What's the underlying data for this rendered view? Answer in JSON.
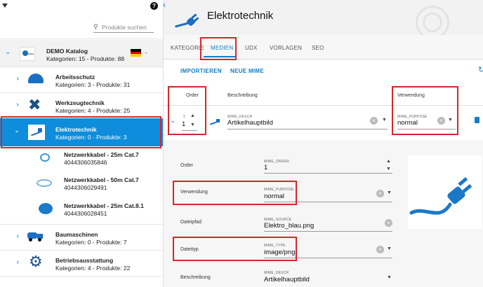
{
  "left": {
    "search_placeholder": "Produkte suchen",
    "catalog": {
      "title": "DEMO Katalog",
      "subtitle": "Kategorien: 15 - Produkte: 88",
      "lang_suffix": "-"
    },
    "categories": [
      {
        "title": "Arbeitsschutz",
        "subtitle": "Kategorien: 3 - Produkte: 31"
      },
      {
        "title": "Werkzeugtechnik",
        "subtitle": "Kategorien: 4 - Produkte: 25"
      },
      {
        "title": "Elektrotechnik",
        "subtitle": "Kategorien: 0 - Produkte: 3"
      },
      {
        "title": "Baumaschinen",
        "subtitle": "Kategorien: 0 - Produkte: 7"
      },
      {
        "title": "Betriebsausstattung",
        "subtitle": "Kategorien: 4 - Produkte: 22"
      }
    ],
    "products": [
      {
        "title": "Netzwerkkabel - 25m Cat.7",
        "ean": "4044306035846"
      },
      {
        "title": "Netzwerkkabel - 50m Cat.7",
        "ean": "4044306029491"
      },
      {
        "title": "Netzwerkkabel - 25m Cat.8.1",
        "ean": "4044306028451"
      }
    ]
  },
  "header": {
    "title": "Elektrotechnik"
  },
  "tabs": [
    "KATEGORIE",
    "MEDIEN",
    "UDX",
    "VORLAGEN",
    "SEO"
  ],
  "actions": {
    "import": "IMPORTIEREN",
    "new": "NEUE MIME"
  },
  "grid": {
    "col_order": "Order",
    "col_desc": "Beschreibung",
    "col_use": "Verwendung",
    "row": {
      "order_tiny": "2",
      "order_value": "1",
      "desc_tiny": "MIME_DESCR",
      "desc_value": "Artikelhauptbild",
      "use_tiny": "MIME_PURPOSE",
      "use_value": "normal"
    }
  },
  "detail": {
    "fields": [
      {
        "label": "Order",
        "tiny": "MIME_ORDER",
        "value": "1"
      },
      {
        "label": "Verwendung",
        "tiny": "MIME_PURPOSE",
        "value": "normal"
      },
      {
        "label": "Dateipfad",
        "tiny": "MIME_SOURCE",
        "value": "Elektro_blau.png"
      },
      {
        "label": "Dateityp",
        "tiny": "MIME_TYPE",
        "value": "image/png"
      },
      {
        "label": "Beschreibung",
        "tiny": "MIME_DESCR",
        "value": "Artikelhauptbild"
      }
    ]
  },
  "colors": {
    "accent": "#0d8ddb",
    "highlight": "#d9252a",
    "tab_active": "#0d7fc8"
  }
}
